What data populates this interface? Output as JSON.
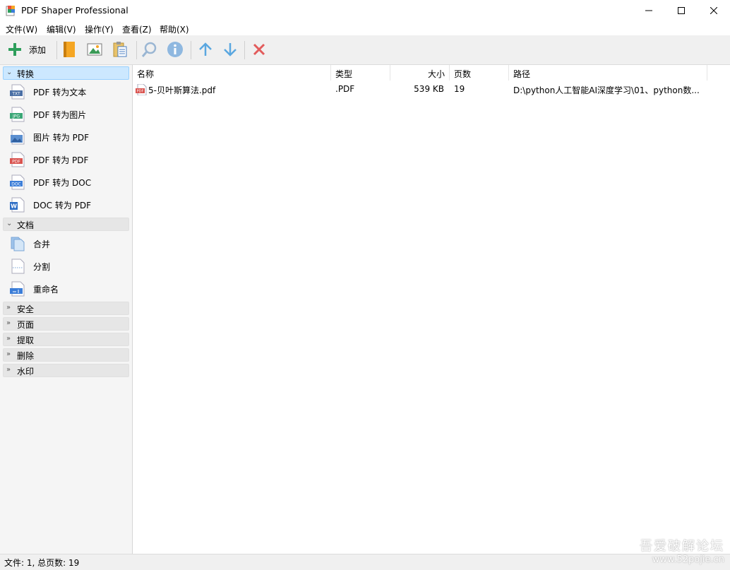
{
  "window": {
    "title": "PDF Shaper Professional",
    "controls": {
      "minimize": "minimize",
      "maximize": "maximize",
      "close": "close"
    }
  },
  "menu": [
    "文件(W)",
    "编辑(V)",
    "操作(Y)",
    "查看(Z)",
    "帮助(X)"
  ],
  "toolbar": {
    "add_label": "添加",
    "icons": [
      "add-icon",
      "book-icon",
      "image-icon",
      "clipboard-icon",
      "search-icon",
      "info-icon",
      "arrow-up-icon",
      "arrow-down-icon",
      "delete-icon"
    ]
  },
  "sidebar": {
    "groups": [
      {
        "label": "转换",
        "expanded": true,
        "items": [
          {
            "label": "PDF 转为文本",
            "icon": "txt-file-icon"
          },
          {
            "label": "PDF 转为图片",
            "icon": "jpg-file-icon"
          },
          {
            "label": "图片 转为 PDF",
            "icon": "image-file-icon"
          },
          {
            "label": "PDF 转为 PDF",
            "icon": "pdf-file-icon"
          },
          {
            "label": "PDF 转为 DOC",
            "icon": "doc-file-icon"
          },
          {
            "label": "DOC 转为 PDF",
            "icon": "word-file-icon"
          }
        ]
      },
      {
        "label": "文档",
        "expanded": true,
        "items": [
          {
            "label": "合并",
            "icon": "merge-icon"
          },
          {
            "label": "分割",
            "icon": "split-icon"
          },
          {
            "label": "重命名",
            "icon": "rename-icon"
          }
        ]
      },
      {
        "label": "安全",
        "expanded": false
      },
      {
        "label": "页面",
        "expanded": false
      },
      {
        "label": "提取",
        "expanded": false
      },
      {
        "label": "删除",
        "expanded": false
      },
      {
        "label": "水印",
        "expanded": false
      }
    ]
  },
  "file_list": {
    "columns": [
      "名称",
      "类型",
      "大小",
      "页数",
      "路径"
    ],
    "rows": [
      {
        "name": "5-贝叶斯算法.pdf",
        "type": ".PDF",
        "size": "539 KB",
        "pages": "19",
        "path": "D:\\python人工智能AI深度学习\\01、python数..."
      }
    ]
  },
  "status": {
    "text": "文件: 1, 总页数: 19"
  },
  "watermark": {
    "line1": "吾爱破解论坛",
    "line2": "www.52pojie.cn"
  },
  "colors": {
    "accent_selected": "#cce8ff",
    "add_green": "#2e9e5b",
    "arrow_blue": "#5aa7e0",
    "delete_red": "#e25b5b"
  }
}
